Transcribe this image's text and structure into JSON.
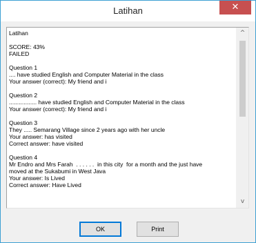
{
  "window": {
    "title": "Latihan",
    "close_glyph": "✕"
  },
  "report": {
    "lines": [
      "Latihan",
      "",
      "SCORE: 43%",
      "FAILED",
      "",
      "Question 1",
      ".... have studied English and Computer Material in the class",
      "Your answer (correct): My friend and i",
      "",
      "Question 2",
      "................. have studied English and Computer Material in the class",
      "Your answer (correct): My friend and i",
      "",
      "Question 3",
      "They ..... Semarang Village since 2 years ago with her uncle",
      "Your answer: has visited",
      "Correct answer: have visited",
      "",
      "Question 4",
      "Mr Endro and Mrs Farah  . . . . . .  in this city  for a month and the just have",
      "moved at the Sukabumi in West Java",
      "Your answer: Is Lived",
      "Correct answer: Have Lived"
    ]
  },
  "scrollbar": {
    "up_glyph": "^",
    "down_glyph": "v"
  },
  "buttons": {
    "ok_label": "OK",
    "print_label": "Print"
  }
}
